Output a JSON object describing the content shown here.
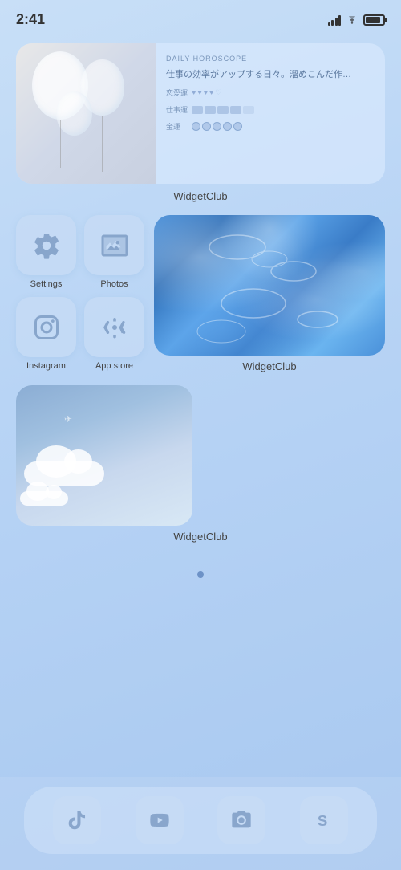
{
  "statusBar": {
    "time": "2:41"
  },
  "horoscope": {
    "title": "DAILY HOROSCOPE",
    "text": "仕事の効率がアップする日々。溜めこんだ作…",
    "loveLabel": "恋愛運",
    "workLabel": "仕事運",
    "moneyLabel": "金運"
  },
  "widgets": {
    "top_label": "WidgetClub",
    "water_label": "WidgetClub",
    "sky_label": "WidgetClub"
  },
  "apps": [
    {
      "name": "Settings",
      "icon": "settings"
    },
    {
      "name": "Photos",
      "icon": "photos"
    },
    {
      "name": "Instagram",
      "icon": "instagram"
    },
    {
      "name": "App store",
      "icon": "appstore"
    }
  ],
  "dock": [
    {
      "name": "TikTok",
      "icon": "tiktok"
    },
    {
      "name": "YouTube",
      "icon": "youtube"
    },
    {
      "name": "Camera",
      "icon": "camera"
    },
    {
      "name": "S App",
      "icon": "s"
    }
  ],
  "pageIndicator": {
    "active": 0,
    "total": 1
  }
}
